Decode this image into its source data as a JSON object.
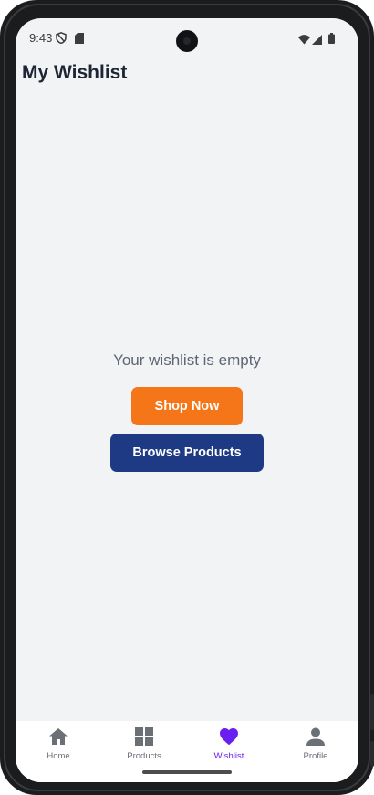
{
  "status_bar": {
    "time": "9:43",
    "icons": [
      "shield-icon",
      "sd-card-icon",
      "camera-cutout",
      "wifi-icon",
      "cellular-signal-icon",
      "battery-icon"
    ]
  },
  "header": {
    "title": "My Wishlist"
  },
  "empty_state": {
    "message": "Your wishlist is empty",
    "shop_now_label": "Shop Now",
    "browse_products_label": "Browse Products"
  },
  "bottom_nav": {
    "active": "Wishlist",
    "items": [
      {
        "label": "Home",
        "icon": "home-icon"
      },
      {
        "label": "Products",
        "icon": "grid-icon"
      },
      {
        "label": "Wishlist",
        "icon": "heart-icon"
      },
      {
        "label": "Profile",
        "icon": "person-icon"
      }
    ]
  },
  "colors": {
    "background": "#f2f3f5",
    "title": "#1e2636",
    "shop_button": "#f57618",
    "browse_button": "#1f3a84",
    "active_nav": "#6a1ff0",
    "inactive_nav": "#6b6f76"
  }
}
